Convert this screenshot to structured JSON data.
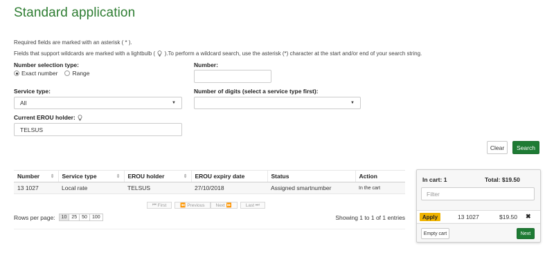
{
  "page": {
    "title": "Standard application"
  },
  "notes": {
    "required": "Required fields are marked with an asterisk ( * ).",
    "wildcard_before": "Fields that support wildcards are marked with a lightbulb (",
    "wildcard_after": ").To perform a wildcard search, use the asterisk (*) character at the start and/or end of your search string."
  },
  "form": {
    "selection_label": "Number selection type:",
    "radio_exact": "Exact number",
    "radio_range": "Range",
    "number_label": "Number:",
    "number_value": "",
    "service_label": "Service type:",
    "service_value": "All",
    "digits_label": "Number of digits (select a service type first):",
    "digits_value": "",
    "holder_label": "Current EROU holder:",
    "holder_value": "TELSUS",
    "clear": "Clear",
    "search": "Search"
  },
  "table": {
    "headers": [
      "Number",
      "Service type",
      "EROU holder",
      "EROU expiry date",
      "Status",
      "Action"
    ],
    "rows": [
      [
        "13 1027",
        "Local rate",
        "TELSUS",
        "27/10/2018",
        "Assigned smartnumber",
        "In the cart"
      ]
    ]
  },
  "pager": {
    "first": "First",
    "previous": "Previous",
    "next": "Next",
    "last": "Last"
  },
  "rows_per_page": {
    "label": "Rows per page:",
    "options": [
      "10",
      "25",
      "50",
      "100"
    ],
    "selected": "10"
  },
  "showing": "Showing 1 to 1 of 1 entries",
  "cart": {
    "in_cart": "In cart: 1",
    "total": "Total: $19.50",
    "filter_placeholder": "Filter",
    "item": {
      "apply": "Apply",
      "number": "13 1027",
      "price": "$19.50"
    },
    "empty": "Empty cart",
    "next": "Next"
  },
  "colors": {
    "brand_green": "#1e7b34",
    "title_green": "#2e7d32",
    "apply_yellow": "#f0b400"
  }
}
